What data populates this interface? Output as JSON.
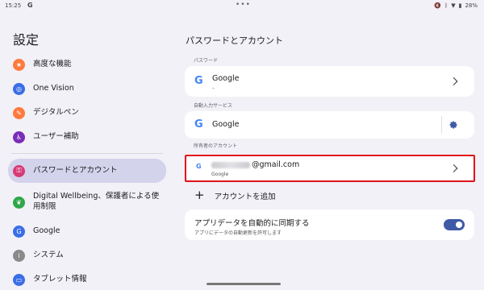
{
  "status_bar": {
    "time": "15:25",
    "g_icon": "G",
    "dots": "•••",
    "battery": "28%",
    "icons": [
      "volume-mute-icon",
      "bluetooth-icon",
      "wifi-icon",
      "battery-icon"
    ]
  },
  "settings": {
    "title": "設定"
  },
  "sidebar": {
    "items": [
      {
        "label": "高度な機能",
        "icon": "star-icon",
        "color": "#ff7a3d"
      },
      {
        "label": "One Vision",
        "icon": "eye-icon",
        "color": "#3a6ee8"
      },
      {
        "label": "デジタルペン",
        "icon": "pen-icon",
        "color": "#ff7a3d"
      },
      {
        "label": "ユーザー補助",
        "icon": "accessibility-icon",
        "color": "#7a2db8"
      },
      {
        "label": "パスワードとアカウント",
        "icon": "key-icon",
        "color": "#d93a75",
        "active": true
      },
      {
        "label": "Digital Wellbeing、保護者による使用制限",
        "icon": "wellbeing-icon",
        "color": "#2ea84a"
      },
      {
        "label": "Google",
        "icon": "google-icon",
        "color": "#3a6ee8"
      },
      {
        "label": "システム",
        "icon": "info-icon",
        "color": "#8a8a8a"
      },
      {
        "label": "タブレット情報",
        "icon": "tablet-icon",
        "color": "#3a6ee8"
      }
    ]
  },
  "main": {
    "title": "パスワードとアカウント",
    "passwords": {
      "header": "パスワード",
      "name": "Google",
      "sub": "–"
    },
    "autofill": {
      "header": "自動入力サービス",
      "name": "Google"
    },
    "accounts": {
      "header": "所有者のアカウント",
      "email_suffix": "@gmail.com",
      "provider": "Google"
    },
    "add_account": {
      "label": "アカウントを追加"
    },
    "sync": {
      "title": "アプリデータを自動的に同期する",
      "sub": "アプリにデータの自動更新を許可します",
      "enabled": true
    }
  }
}
